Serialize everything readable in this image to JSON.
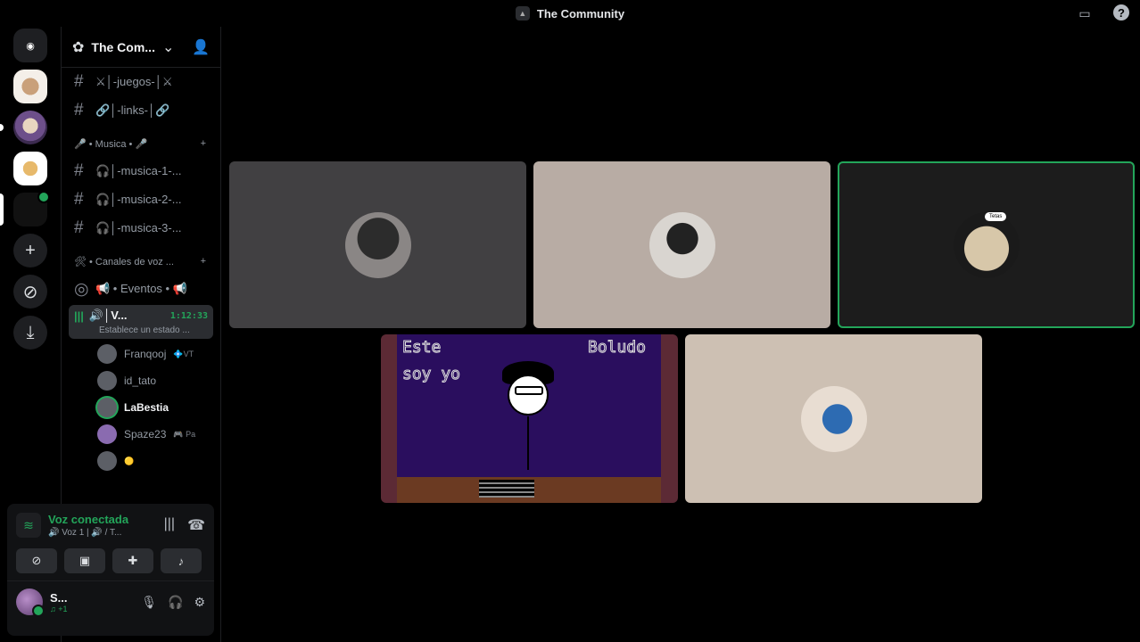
{
  "window": {
    "title": "The Community"
  },
  "guild": {
    "name": "The Com..."
  },
  "channels": [
    {
      "name": "⚔│-juegos-│⚔"
    },
    {
      "name": "🔗│-links-│🔗"
    }
  ],
  "categories": {
    "music": "🎤 • Musica • 🎤",
    "voice": "🛠 • Canales de voz ..."
  },
  "music_channels": [
    {
      "name": "🎧│-musica-1-..."
    },
    {
      "name": "🎧│-musica-2-..."
    },
    {
      "name": "🎧│-musica-3-..."
    }
  ],
  "events_channel": {
    "name": "📢 • Eventos • 📢"
  },
  "active_voice": {
    "name": "🔊│V...",
    "timer": "1:12:33",
    "status": "Establece un estado ..."
  },
  "voice_users": [
    {
      "name": "Franqooj",
      "tag": "💠VT"
    },
    {
      "name": "id_tato",
      "tag": ""
    },
    {
      "name": "LaBestia",
      "tag": ""
    },
    {
      "name": "Spaze23",
      "tag": "🎮 Pa"
    },
    {
      "name": "",
      "tag": "🟡"
    }
  ],
  "voice_panel": {
    "status": "Voz conectada",
    "sub": "🔊 Voz 1 | 🔊 / T..."
  },
  "me": {
    "name": "S...",
    "sub": "♫ +1"
  },
  "stage": {
    "bubble_text": "Tetas",
    "scene_text_1": "Este",
    "scene_text_2": "soy yo",
    "scene_text_3": "Boludo"
  },
  "colors": {
    "accent_green": "#23a55a",
    "background": "#000000",
    "panel": "#111214"
  }
}
